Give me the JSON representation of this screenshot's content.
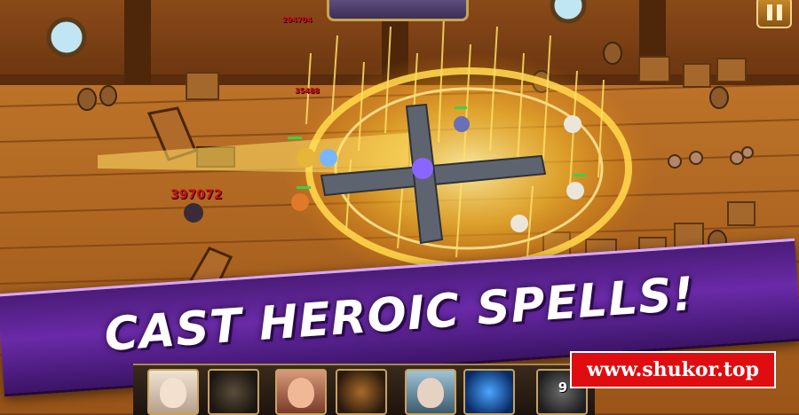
{
  "headline": "CAST HEROIC SPELLS!",
  "watermark": "www.shukor.top",
  "damage_numbers": {
    "main": "397072",
    "small_1": "294704",
    "small_2": "35488"
  },
  "hud": {
    "cooldown_count": "9"
  },
  "icons": [
    "pause-icon",
    "hero-portrait-icon",
    "spell-icon"
  ],
  "colors": {
    "banner": "#5a22a0",
    "spell_glow": "#ffd54a",
    "watermark_bg": "#e00d10",
    "deck": "#b8702a"
  }
}
